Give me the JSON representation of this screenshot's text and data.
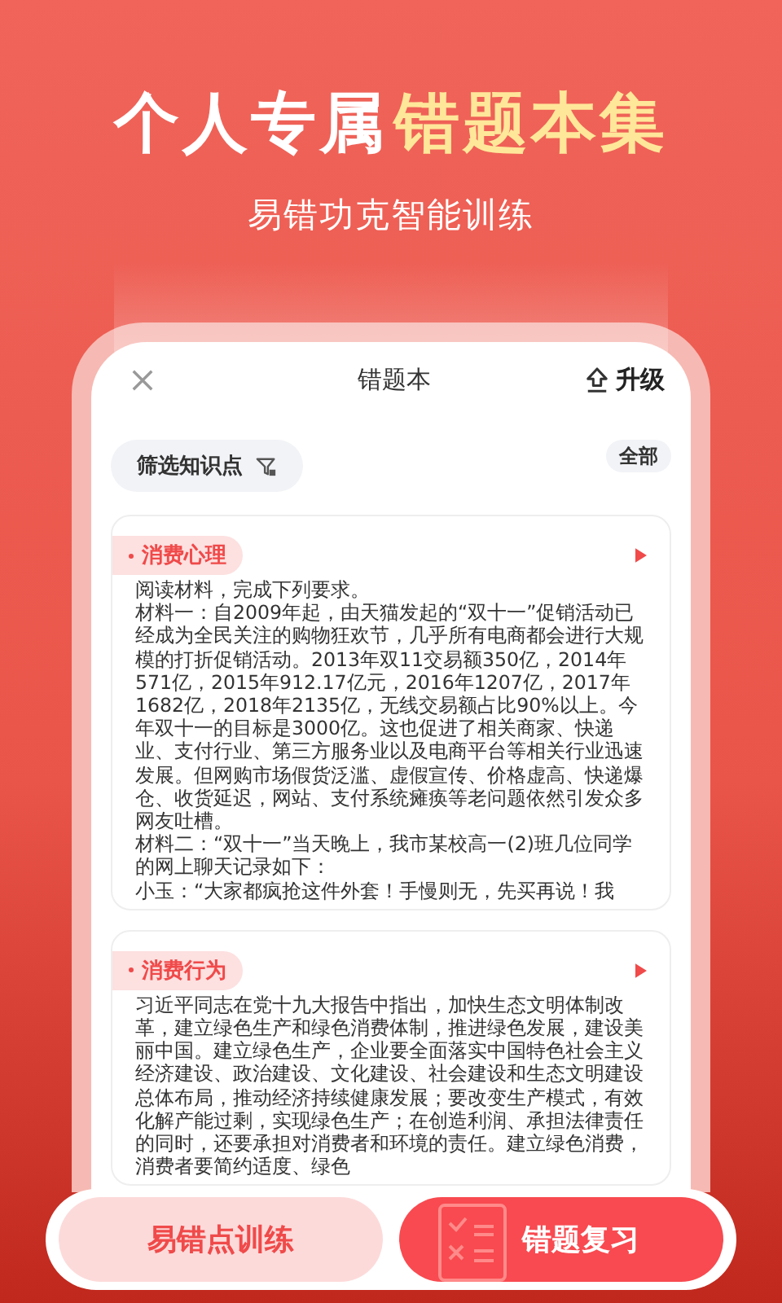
{
  "hero": {
    "title_plain": "个人专属",
    "title_highlight": "错题本集",
    "subtitle": "易错功克智能训练"
  },
  "app": {
    "title": "错题本",
    "upgrade": "升级",
    "filter": "筛选知识点",
    "scope": "全部"
  },
  "questions": [
    {
      "tag": "消费心理",
      "paragraphs": [
        "阅读材料，完成下列要求。",
        "材料一：自2009年起，由天猫发起的“双十一”促销活动已经成为全民关注的购物狂欢节，几乎所有电商都会进行大规模的打折促销活动。2013年双11交易额350亿，2014年571亿，2015年912.17亿元，2016年1207亿，2017年1682亿，2018年2135亿，无线交易额占比90%以上。今年双十一的目标是3000亿。这也促进了相关商家、快递业、支付行业、第三方服务业以及电商平台等相关行业迅速发展。但网购市场假货泛滥、虚假宣传、价格虚高、快递爆仓、收货延迟，网站、支付系统瘫痪等老问题依然引发众多网友吐槽。",
        "材料二：“双十一”当天晚上，我市某校高一(2)班几位同学的网上聊天记录如下：",
        "小玉：“大家都疯抢这件外套！手慢则无，先买再说！我"
      ]
    },
    {
      "tag": "消费行为",
      "paragraphs": [
        "习近平同志在党十九大报告中指出，加快生态文明体制改革，建立绿色生产和绿色消费体制，推进绿色发展，建设美丽中国。建立绿色生产，企业要全面落实中国特色社会主义经济建设、政治建设、文化建设、社会建设和生态文明建设总体布局，推动经济持续健康发展；要改变生产模式，有效化解产能过剩，实现绿色生产；在创造利润、承担法律责任的同时，还要承担对消费者和环境的责任。建立绿色消费，消费者要简约适度、绿色"
      ]
    }
  ],
  "actions": [
    {
      "label": "易错点训练",
      "kind": "secondary"
    },
    {
      "label": "错题复习",
      "kind": "primary"
    }
  ]
}
